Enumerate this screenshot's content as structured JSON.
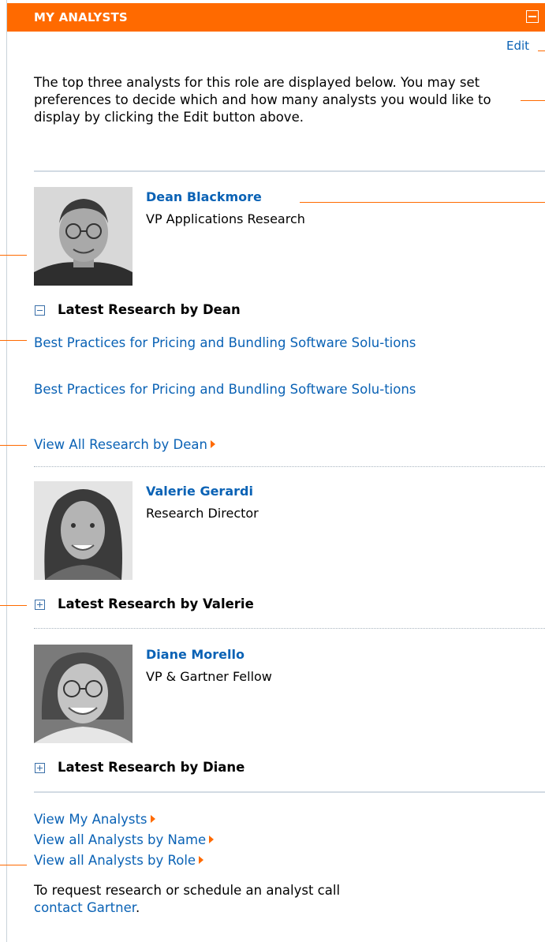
{
  "header": {
    "title": "MY ANALYSTS"
  },
  "edit_label": "Edit",
  "intro": "The top three analysts for this role are displayed below. You may set preferences to decide which and how many analysts you would like to display by clicking the Edit button above.",
  "analysts": [
    {
      "name": "Dean Blackmore",
      "title": "VP Applications Research",
      "latest_label": "Latest Research by Dean",
      "expanded": true,
      "documents": [
        "Best Practices for Pricing and Bundling Software Solu-tions",
        "Best Practices for Pricing and Bundling Software Solu-tions"
      ],
      "view_all": "View All Research by Dean"
    },
    {
      "name": "Valerie Gerardi",
      "title": "Research Director",
      "latest_label": "Latest Research by Valerie",
      "expanded": false
    },
    {
      "name": "Diane Morello",
      "title": "VP & Gartner Fellow",
      "latest_label": "Latest Research by Diane",
      "expanded": false
    }
  ],
  "footer_links": {
    "my": "View My Analysts",
    "by_name": "View all Analysts by Name",
    "by_role": "View all Analysts by Role"
  },
  "footer": {
    "text": "To request research or schedule an analyst call",
    "contact": "contact Gartner",
    "period": "."
  },
  "colors": {
    "accent": "#ff6a00",
    "link": "#0a62b5"
  },
  "icons": {
    "collapse": "minus-square-icon",
    "expand": "plus-square-icon",
    "arrow": "triangle-right-icon"
  }
}
